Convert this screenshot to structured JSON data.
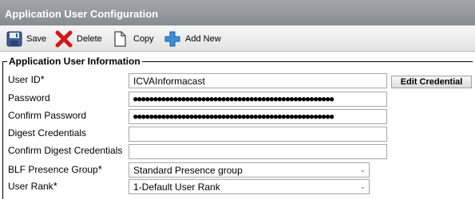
{
  "window": {
    "title": "Application User Configuration"
  },
  "toolbar": {
    "save": {
      "label": "Save",
      "icon": "floppy-disk-icon"
    },
    "delete": {
      "label": "Delete",
      "icon": "red-x-icon"
    },
    "copy": {
      "label": "Copy",
      "icon": "copy-icon"
    },
    "add_new": {
      "label": "Add New",
      "icon": "plus-icon"
    }
  },
  "section": {
    "title": "Application User Information",
    "required_marker": "*",
    "fields": {
      "user_id": {
        "label": "User ID",
        "value": "ICVAInformacast"
      },
      "password": {
        "label": "Password",
        "value": "●●●●●●●●●●●●●●●●●●●●●●●●●●●●●●●●●●●●●●●●●●●●●●●●●●"
      },
      "confirm_password": {
        "label": "Confirm Password",
        "value": "●●●●●●●●●●●●●●●●●●●●●●●●●●●●●●●●●●●●●●●●●●●●●●●●●●"
      },
      "digest_credentials": {
        "label": "Digest Credentials",
        "value": ""
      },
      "confirm_digest_credentials": {
        "label": "Confirm Digest Credentials",
        "value": ""
      },
      "blf_presence_group": {
        "label": "BLF Presence Group",
        "value": "Standard Presence group"
      },
      "user_rank": {
        "label": "User Rank",
        "value": "1-Default User Rank"
      }
    },
    "edit_credential_label": "Edit Credential"
  },
  "colors": {
    "titlebar": "#8b8f96",
    "delete_red": "#d4161a",
    "add_blue": "#3c8fd8"
  }
}
